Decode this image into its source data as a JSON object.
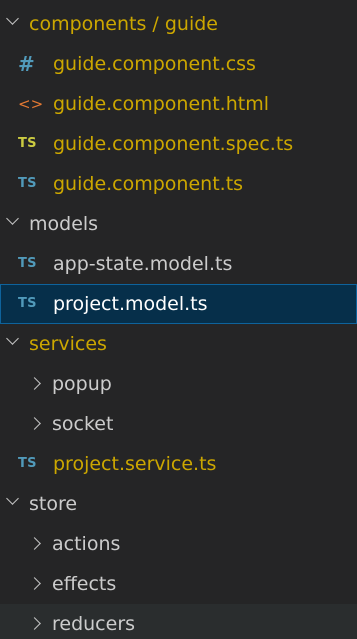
{
  "explorer": {
    "items": [
      {
        "label": "components / guide",
        "kind": "folder",
        "expanded": true,
        "color": "#cca700"
      },
      {
        "label": "guide.component.css",
        "kind": "file",
        "icon": "#",
        "icon_name": "css-file-icon",
        "icon_color": "#519aba",
        "color": "#cca700"
      },
      {
        "label": "guide.component.html",
        "kind": "file",
        "icon": "<>",
        "icon_name": "html-file-icon",
        "icon_color": "#e37933",
        "color": "#cca700"
      },
      {
        "label": "guide.component.spec.ts",
        "kind": "file",
        "icon": "TS",
        "icon_name": "typescript-spec-file-icon",
        "icon_color": "#cbcb41",
        "color": "#cca700"
      },
      {
        "label": "guide.component.ts",
        "kind": "file",
        "icon": "TS",
        "icon_name": "typescript-file-icon",
        "icon_color": "#519aba",
        "color": "#cca700"
      },
      {
        "label": "models",
        "kind": "folder",
        "expanded": true,
        "color": "#cccccc"
      },
      {
        "label": "app-state.model.ts",
        "kind": "file",
        "icon": "TS",
        "icon_name": "typescript-file-icon",
        "icon_color": "#519aba",
        "color": "#cccccc"
      },
      {
        "label": "project.model.ts",
        "kind": "file",
        "icon": "TS",
        "icon_name": "typescript-file-icon",
        "icon_color": "#519aba",
        "color": "#ffffff",
        "selected": true
      },
      {
        "label": "services",
        "kind": "folder",
        "expanded": true,
        "color": "#cca700"
      },
      {
        "label": "popup",
        "kind": "folder",
        "expanded": false,
        "color": "#cccccc"
      },
      {
        "label": "socket",
        "kind": "folder",
        "expanded": false,
        "color": "#cccccc"
      },
      {
        "label": "project.service.ts",
        "kind": "file",
        "icon": "TS",
        "icon_name": "typescript-file-icon",
        "icon_color": "#519aba",
        "color": "#cca700"
      },
      {
        "label": "store",
        "kind": "folder",
        "expanded": true,
        "color": "#cccccc"
      },
      {
        "label": "actions",
        "kind": "folder",
        "expanded": false,
        "color": "#cccccc"
      },
      {
        "label": "effects",
        "kind": "folder",
        "expanded": false,
        "color": "#cccccc"
      },
      {
        "label": "reducers",
        "kind": "folder",
        "expanded": false,
        "color": "#cccccc",
        "hovered": true
      }
    ]
  }
}
